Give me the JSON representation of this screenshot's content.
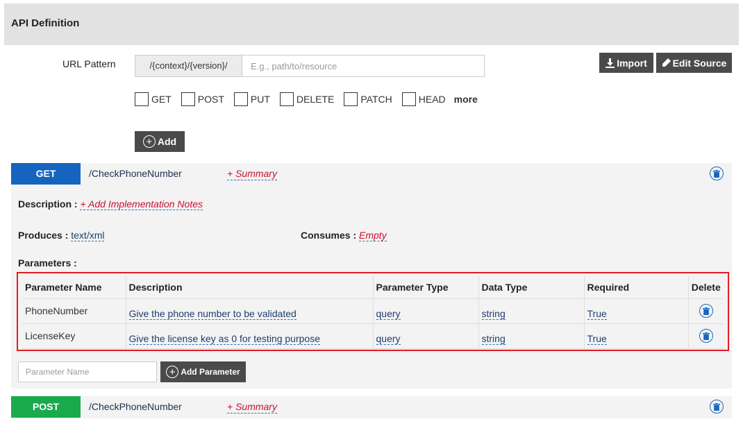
{
  "header": {
    "title": "API Definition"
  },
  "url": {
    "label": "URL Pattern",
    "prefix": "/{context}/{version}/",
    "placeholder": "E.g., path/to/resource"
  },
  "toolbar": {
    "import_label": "Import",
    "edit_source_label": "Edit Source"
  },
  "methods": [
    "GET",
    "POST",
    "PUT",
    "DELETE",
    "PATCH",
    "HEAD"
  ],
  "more_label": "more",
  "add_label": "Add",
  "operations": [
    {
      "verb": "GET",
      "path": "/CheckPhoneNumber",
      "summary": "+ Summary",
      "description_label": "Description :",
      "description_value": "+ Add Implementation Notes",
      "produces_label": "Produces :",
      "produces_value": "text/xml",
      "consumes_label": "Consumes :",
      "consumes_value": "Empty",
      "parameters_label": "Parameters :",
      "columns": [
        "Parameter Name",
        "Description",
        "Parameter Type",
        "Data Type",
        "Required",
        "Delete"
      ],
      "parameters": [
        {
          "name": "PhoneNumber",
          "description": "Give the phone number to be validated",
          "type": "query",
          "data_type": "string",
          "required": "True"
        },
        {
          "name": "LicenseKey",
          "description": "Give the license key as 0 for testing purpose",
          "type": "query",
          "data_type": "string",
          "required": "True"
        }
      ],
      "param_placeholder": "Parameter Name",
      "add_param_label": "Add Parameter"
    },
    {
      "verb": "POST",
      "path": "/CheckPhoneNumber",
      "summary": "+ Summary"
    }
  ],
  "colors": {
    "get": "#1565c0",
    "post": "#1aaa4e",
    "highlight": "#e31b23",
    "button": "#4a4a4a"
  }
}
